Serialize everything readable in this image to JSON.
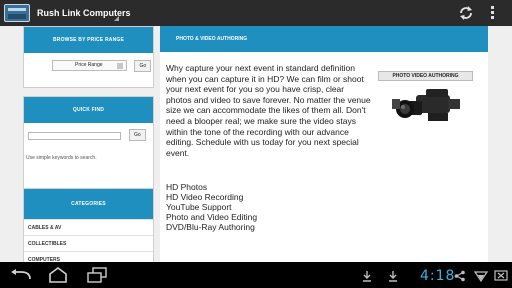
{
  "action_bar": {
    "title": "Rush Link Computers",
    "icons": {
      "app": "app-logo-icon",
      "refresh": "refresh-icon",
      "overflow": "overflow-menu-icon"
    }
  },
  "sidebar": {
    "price_box": {
      "title": "BROWSE BY PRICE RANGE",
      "select_value": "Price Range",
      "button": "Go"
    },
    "quick_find": {
      "title": "QUICK FIND",
      "button": "Go",
      "hint": "Use simple keywords to search.",
      "input_value": ""
    },
    "categories": {
      "title": "CATEGORIES",
      "items": [
        "CABLES & AV",
        "COLLECTIBLES",
        "COMPUTERS"
      ]
    }
  },
  "main": {
    "title": "PHOTO & VIDEO AUTHORING",
    "body": "Why capture your next event in standard definition when you can capture it in HD? We can film or shoot your next event for you so you have crisp, clear photos and video to save forever. No matter the venue size we can accommodate the likes of them all. Don't need a blooper real; we make sure the video stays within the tone of the recording with our advance editing. Schedule with us today for you next special event.",
    "services": [
      "HD Photos",
      "HD Video Recording",
      "YouTube Support",
      "Photo and Video Editing",
      "DVD/Blu-Ray Authoring"
    ],
    "promo_banner": "PHOTO VIDEO AUTHORING"
  },
  "nav_bar": {
    "time": "4:18",
    "icons": [
      "back-icon",
      "home-icon",
      "recent-apps-icon",
      "download-icon",
      "download-icon",
      "share-icon",
      "wifi-icon",
      "battery-icon"
    ]
  },
  "colors": {
    "accent": "#1f8fbf",
    "action_bar": "#2b2b2b",
    "clock": "#33b5e5"
  }
}
